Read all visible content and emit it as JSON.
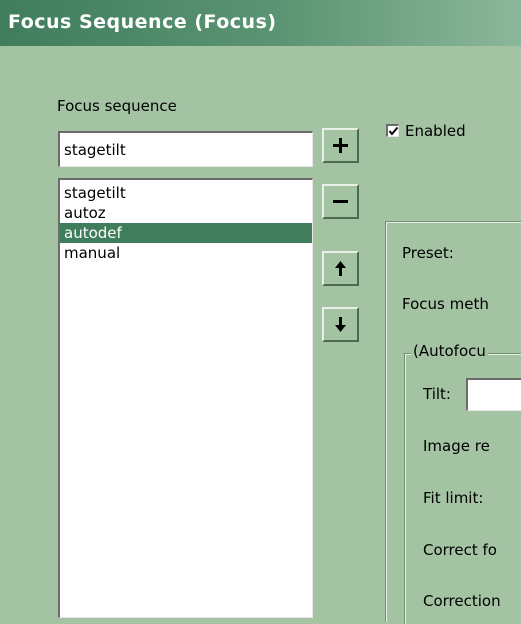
{
  "window": {
    "title": "Focus Sequence (Focus)"
  },
  "sequence": {
    "label": "Focus sequence",
    "input_value": "stagetilt",
    "items": [
      "stagetilt",
      "autoz",
      "autodef",
      "manual"
    ],
    "selected_index": 2
  },
  "buttons": {
    "add": {
      "icon": "plus-icon"
    },
    "remove": {
      "icon": "minus-icon"
    },
    "move_up": {
      "icon": "arrow-up-icon"
    },
    "move_down": {
      "icon": "arrow-down-icon"
    }
  },
  "enabled": {
    "label": "Enabled",
    "checked": true
  },
  "settings": {
    "preset_label": "Preset:",
    "focus_method_label": "Focus meth",
    "group_title": "(Autofocu",
    "tilt_label": "Tilt:",
    "tilt_value": "",
    "image_reg_label": "Image re",
    "fit_limit_label": "Fit limit:",
    "correct_label": "Correct fo",
    "correction_label": "Correction"
  },
  "colors": {
    "window_bg": "#a3c3a3",
    "titlebar": "#3f7d5c",
    "selection": "#3f7d5c"
  }
}
